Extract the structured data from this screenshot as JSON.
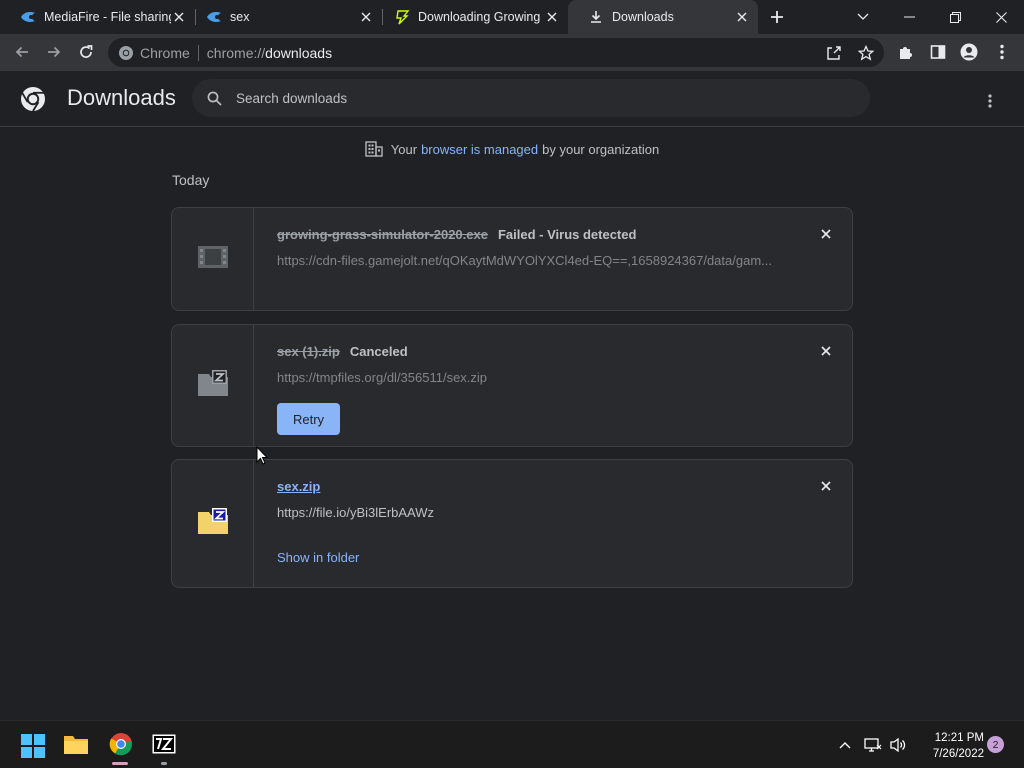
{
  "tabs": [
    {
      "title": "MediaFire - File sharing",
      "favicon": "mediafire-icon"
    },
    {
      "title": "sex",
      "favicon": "mediafire-icon"
    },
    {
      "title": "Downloading Growing",
      "favicon": "gamejolt-icon"
    },
    {
      "title": "Downloads",
      "favicon": "download-icon",
      "active": true
    }
  ],
  "omnibox": {
    "site_label": "Chrome",
    "url_scheme": "chrome://",
    "url_host": "downloads"
  },
  "page": {
    "title": "Downloads",
    "search_placeholder": "Search downloads"
  },
  "managed": {
    "before": "Your",
    "link": "browser is managed",
    "after": "by your organization"
  },
  "section_label": "Today",
  "downloads": [
    {
      "filename": "growing-grass-simulator-2020.exe",
      "status": "Failed - Virus detected",
      "url": "https://cdn-files.gamejolt.net/qOKaytMdWYOlYXCl4ed-EQ==,1658924367/data/gam..."
    },
    {
      "filename": "sex (1).zip",
      "status": "Canceled",
      "url": "https://tmpfiles.org/dl/356511/sex.zip",
      "action": "Retry"
    },
    {
      "filename": "sex.zip",
      "url": "https://file.io/yBi3lErbAAWz",
      "action": "Show in folder"
    }
  ],
  "taskbar": {
    "time": "12:21 PM",
    "date": "7/26/2022",
    "notifications": "2"
  },
  "colors": {
    "background": "#202124",
    "toolbar": "#35363a",
    "accent": "#8ab4f8",
    "card": "#292a2d"
  }
}
